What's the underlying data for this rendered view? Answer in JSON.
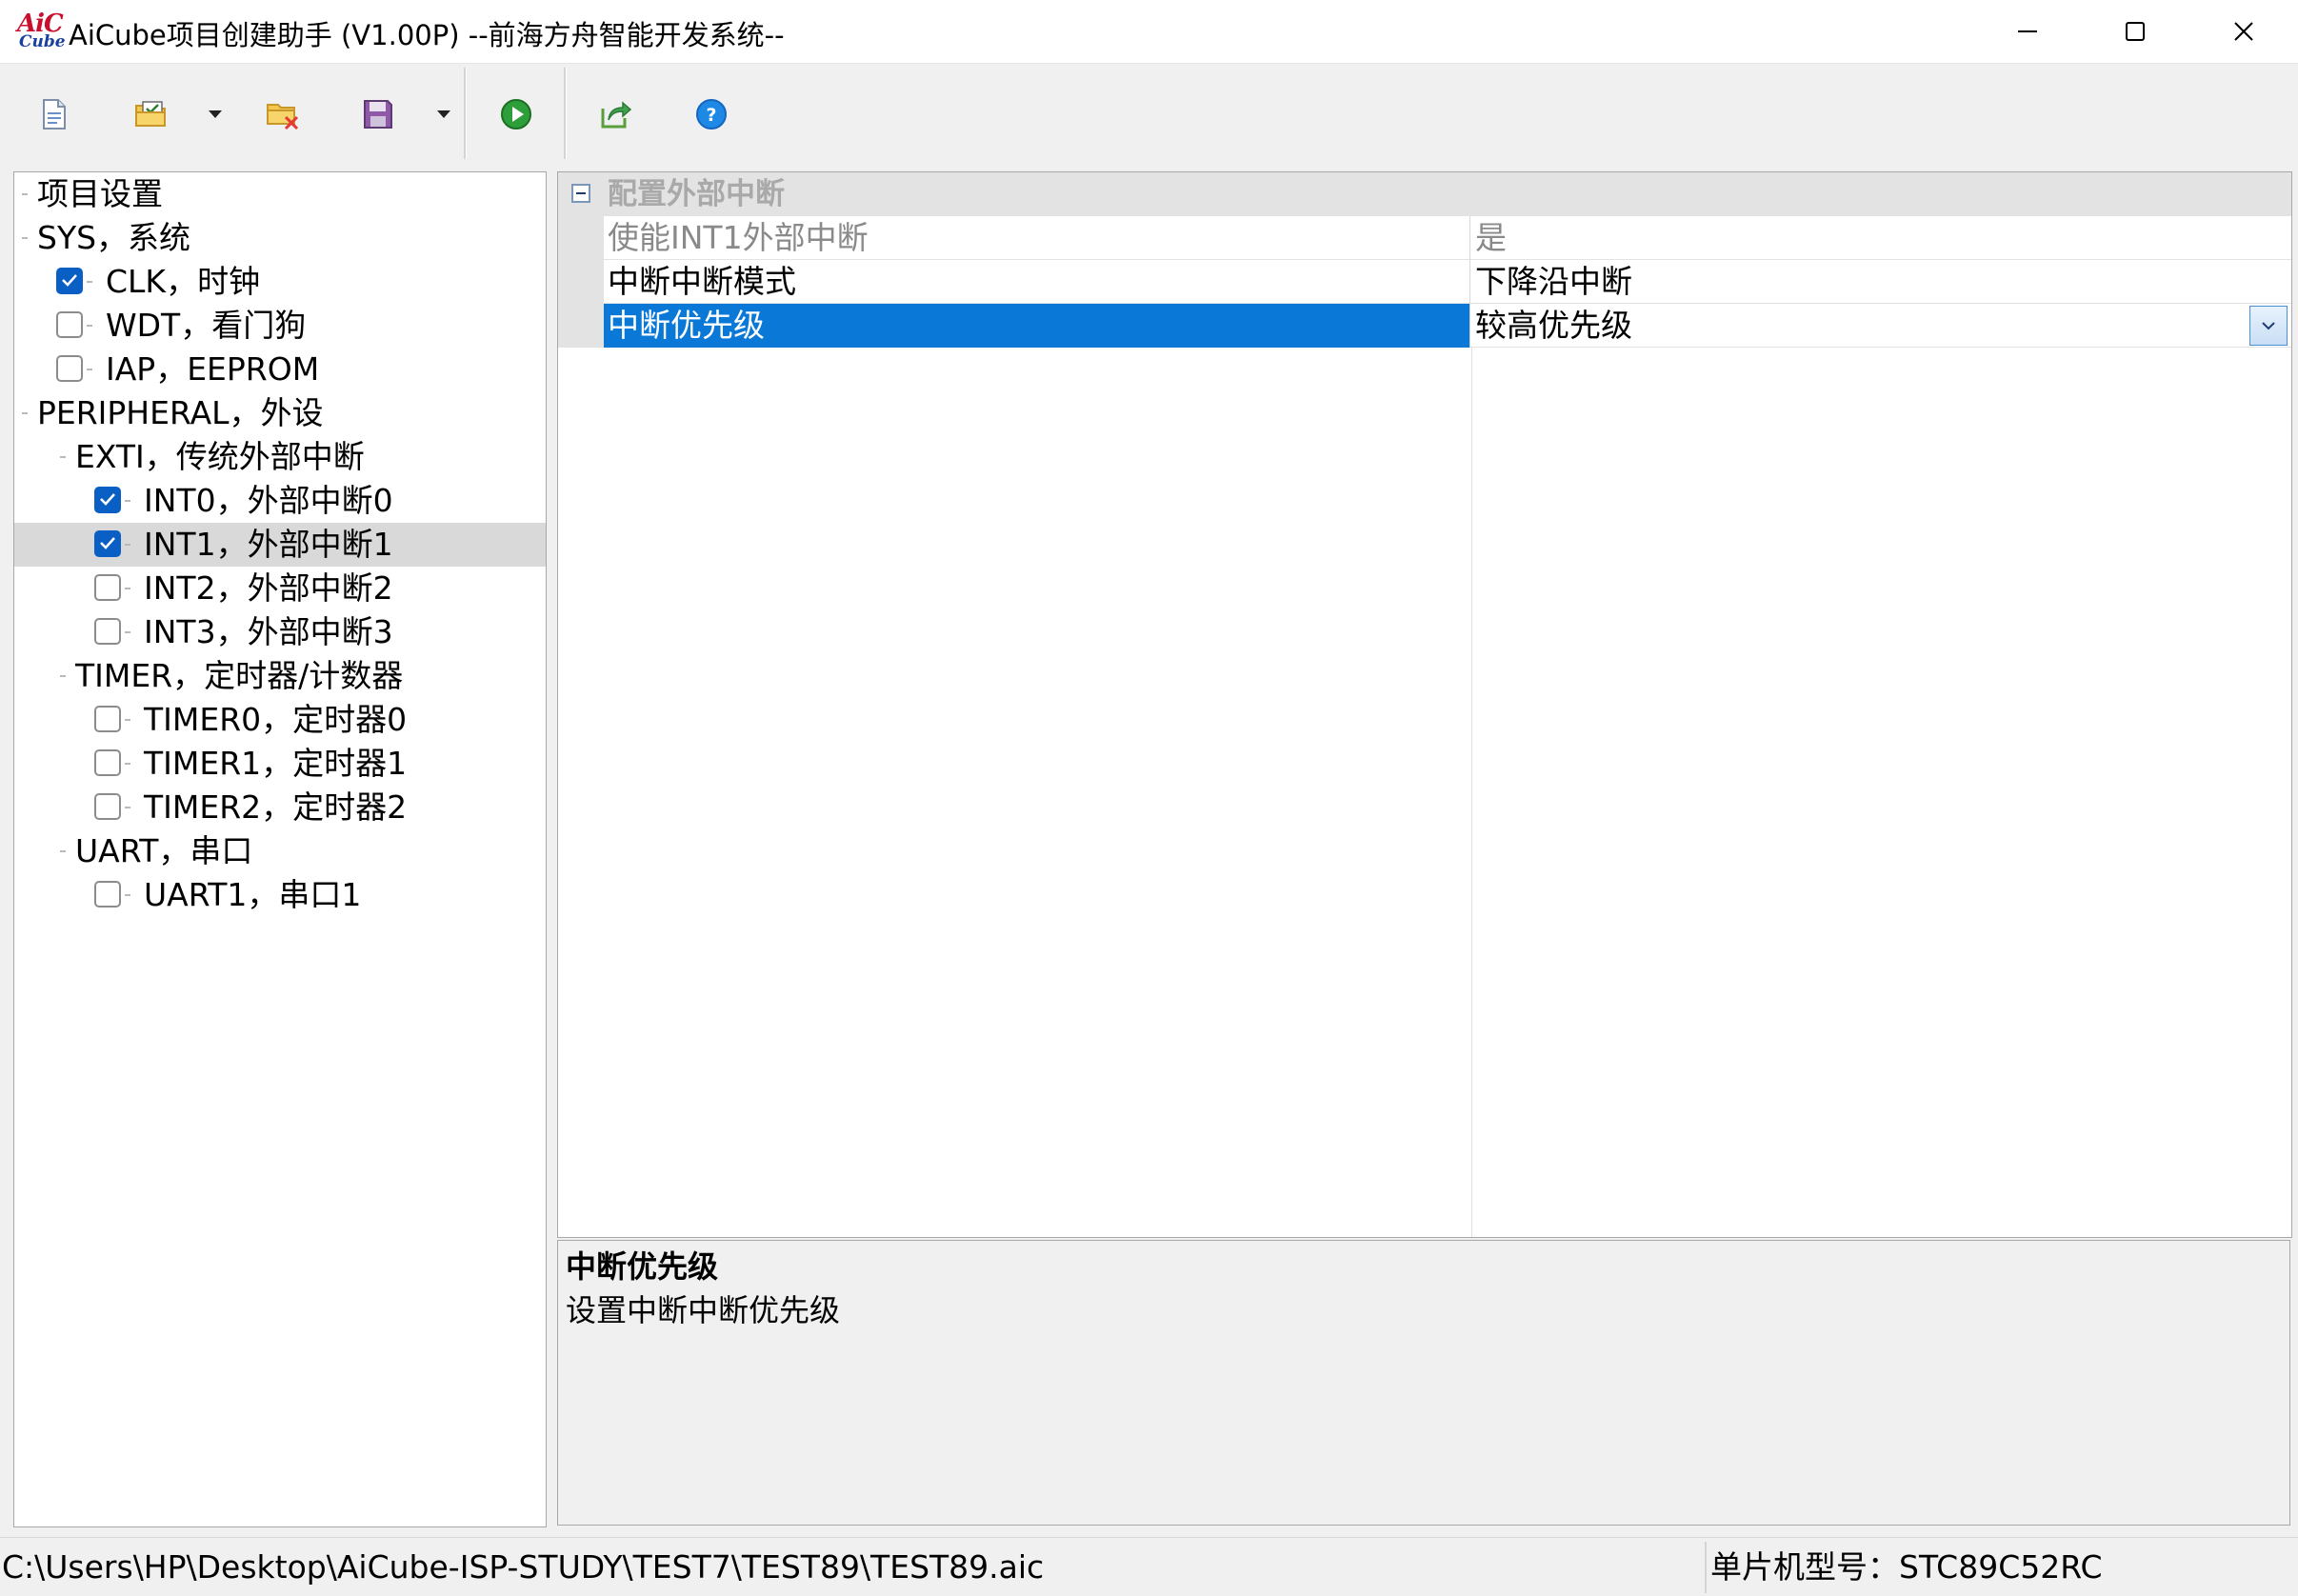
{
  "window": {
    "title": "AiCube项目创建助手 (V1.00P) --前海方舟智能开发系统--",
    "logo_top": "AiC",
    "logo_bottom": "Cube",
    "controls": [
      "minimize-icon",
      "maximize-icon",
      "close-icon"
    ]
  },
  "toolbar": {
    "buttons": [
      {
        "name": "new-project",
        "icon": "new-document-icon"
      },
      {
        "name": "open-project",
        "icon": "open-folder-icon",
        "has_dropdown": true
      },
      {
        "name": "close-project",
        "icon": "folder-delete-icon"
      },
      {
        "name": "save-project",
        "icon": "save-disk-icon",
        "has_dropdown": true
      },
      {
        "name": "run-generate",
        "icon": "play-icon"
      },
      {
        "name": "export",
        "icon": "export-arrow-icon"
      },
      {
        "name": "help",
        "icon": "help-icon"
      }
    ]
  },
  "tree": {
    "items": [
      {
        "label": "项目设置",
        "level": 0,
        "checkbox": false
      },
      {
        "label": "SYS，系统",
        "level": 0,
        "checkbox": false,
        "expanded": true
      },
      {
        "label": "CLK，时钟",
        "level": 1,
        "checkbox": true,
        "checked": true
      },
      {
        "label": "WDT，看门狗",
        "level": 1,
        "checkbox": true,
        "checked": false
      },
      {
        "label": "IAP，EEPROM",
        "level": 1,
        "checkbox": true,
        "checked": false
      },
      {
        "label": "PERIPHERAL，外设",
        "level": 0,
        "checkbox": false,
        "expanded": true
      },
      {
        "label": "EXTI，传统外部中断",
        "level": 1,
        "checkbox": false,
        "expanded": true
      },
      {
        "label": "INT0，外部中断0",
        "level": 2,
        "checkbox": true,
        "checked": true
      },
      {
        "label": "INT1，外部中断1",
        "level": 2,
        "checkbox": true,
        "checked": true,
        "selected": true
      },
      {
        "label": "INT2，外部中断2",
        "level": 2,
        "checkbox": true,
        "checked": false
      },
      {
        "label": "INT3，外部中断3",
        "level": 2,
        "checkbox": true,
        "checked": false
      },
      {
        "label": "TIMER，定时器/计数器",
        "level": 1,
        "checkbox": false,
        "expanded": true
      },
      {
        "label": "TIMER0，定时器0",
        "level": 2,
        "checkbox": true,
        "checked": false
      },
      {
        "label": "TIMER1，定时器1",
        "level": 2,
        "checkbox": true,
        "checked": false
      },
      {
        "label": "TIMER2，定时器2",
        "level": 2,
        "checkbox": true,
        "checked": false
      },
      {
        "label": "UART，串口",
        "level": 1,
        "checkbox": false,
        "expanded": true
      },
      {
        "label": "UART1，串口1",
        "level": 2,
        "checkbox": true,
        "checked": false
      }
    ]
  },
  "property_grid": {
    "category": "配置外部中断",
    "rows": [
      {
        "key": "使能INT1外部中断",
        "value": "是",
        "readonly": true
      },
      {
        "key": "中断中断模式",
        "value": "下降沿中断"
      },
      {
        "key": "中断优先级",
        "value": "较高优先级",
        "selected": true,
        "dropdown": true
      }
    ]
  },
  "description": {
    "title": "中断优先级",
    "text": "设置中断中断优先级"
  },
  "status": {
    "path": "C:\\Users\\HP\\Desktop\\AiCube-ISP-STUDY\\TEST7\\TEST89\\TEST89.aic",
    "mcu": "单片机型号：STC89C52RC"
  },
  "colors": {
    "selection_blue": "#0a78d7",
    "checkbox_blue": "#0a5fc4",
    "tree_selected": "#d9d9d9"
  }
}
